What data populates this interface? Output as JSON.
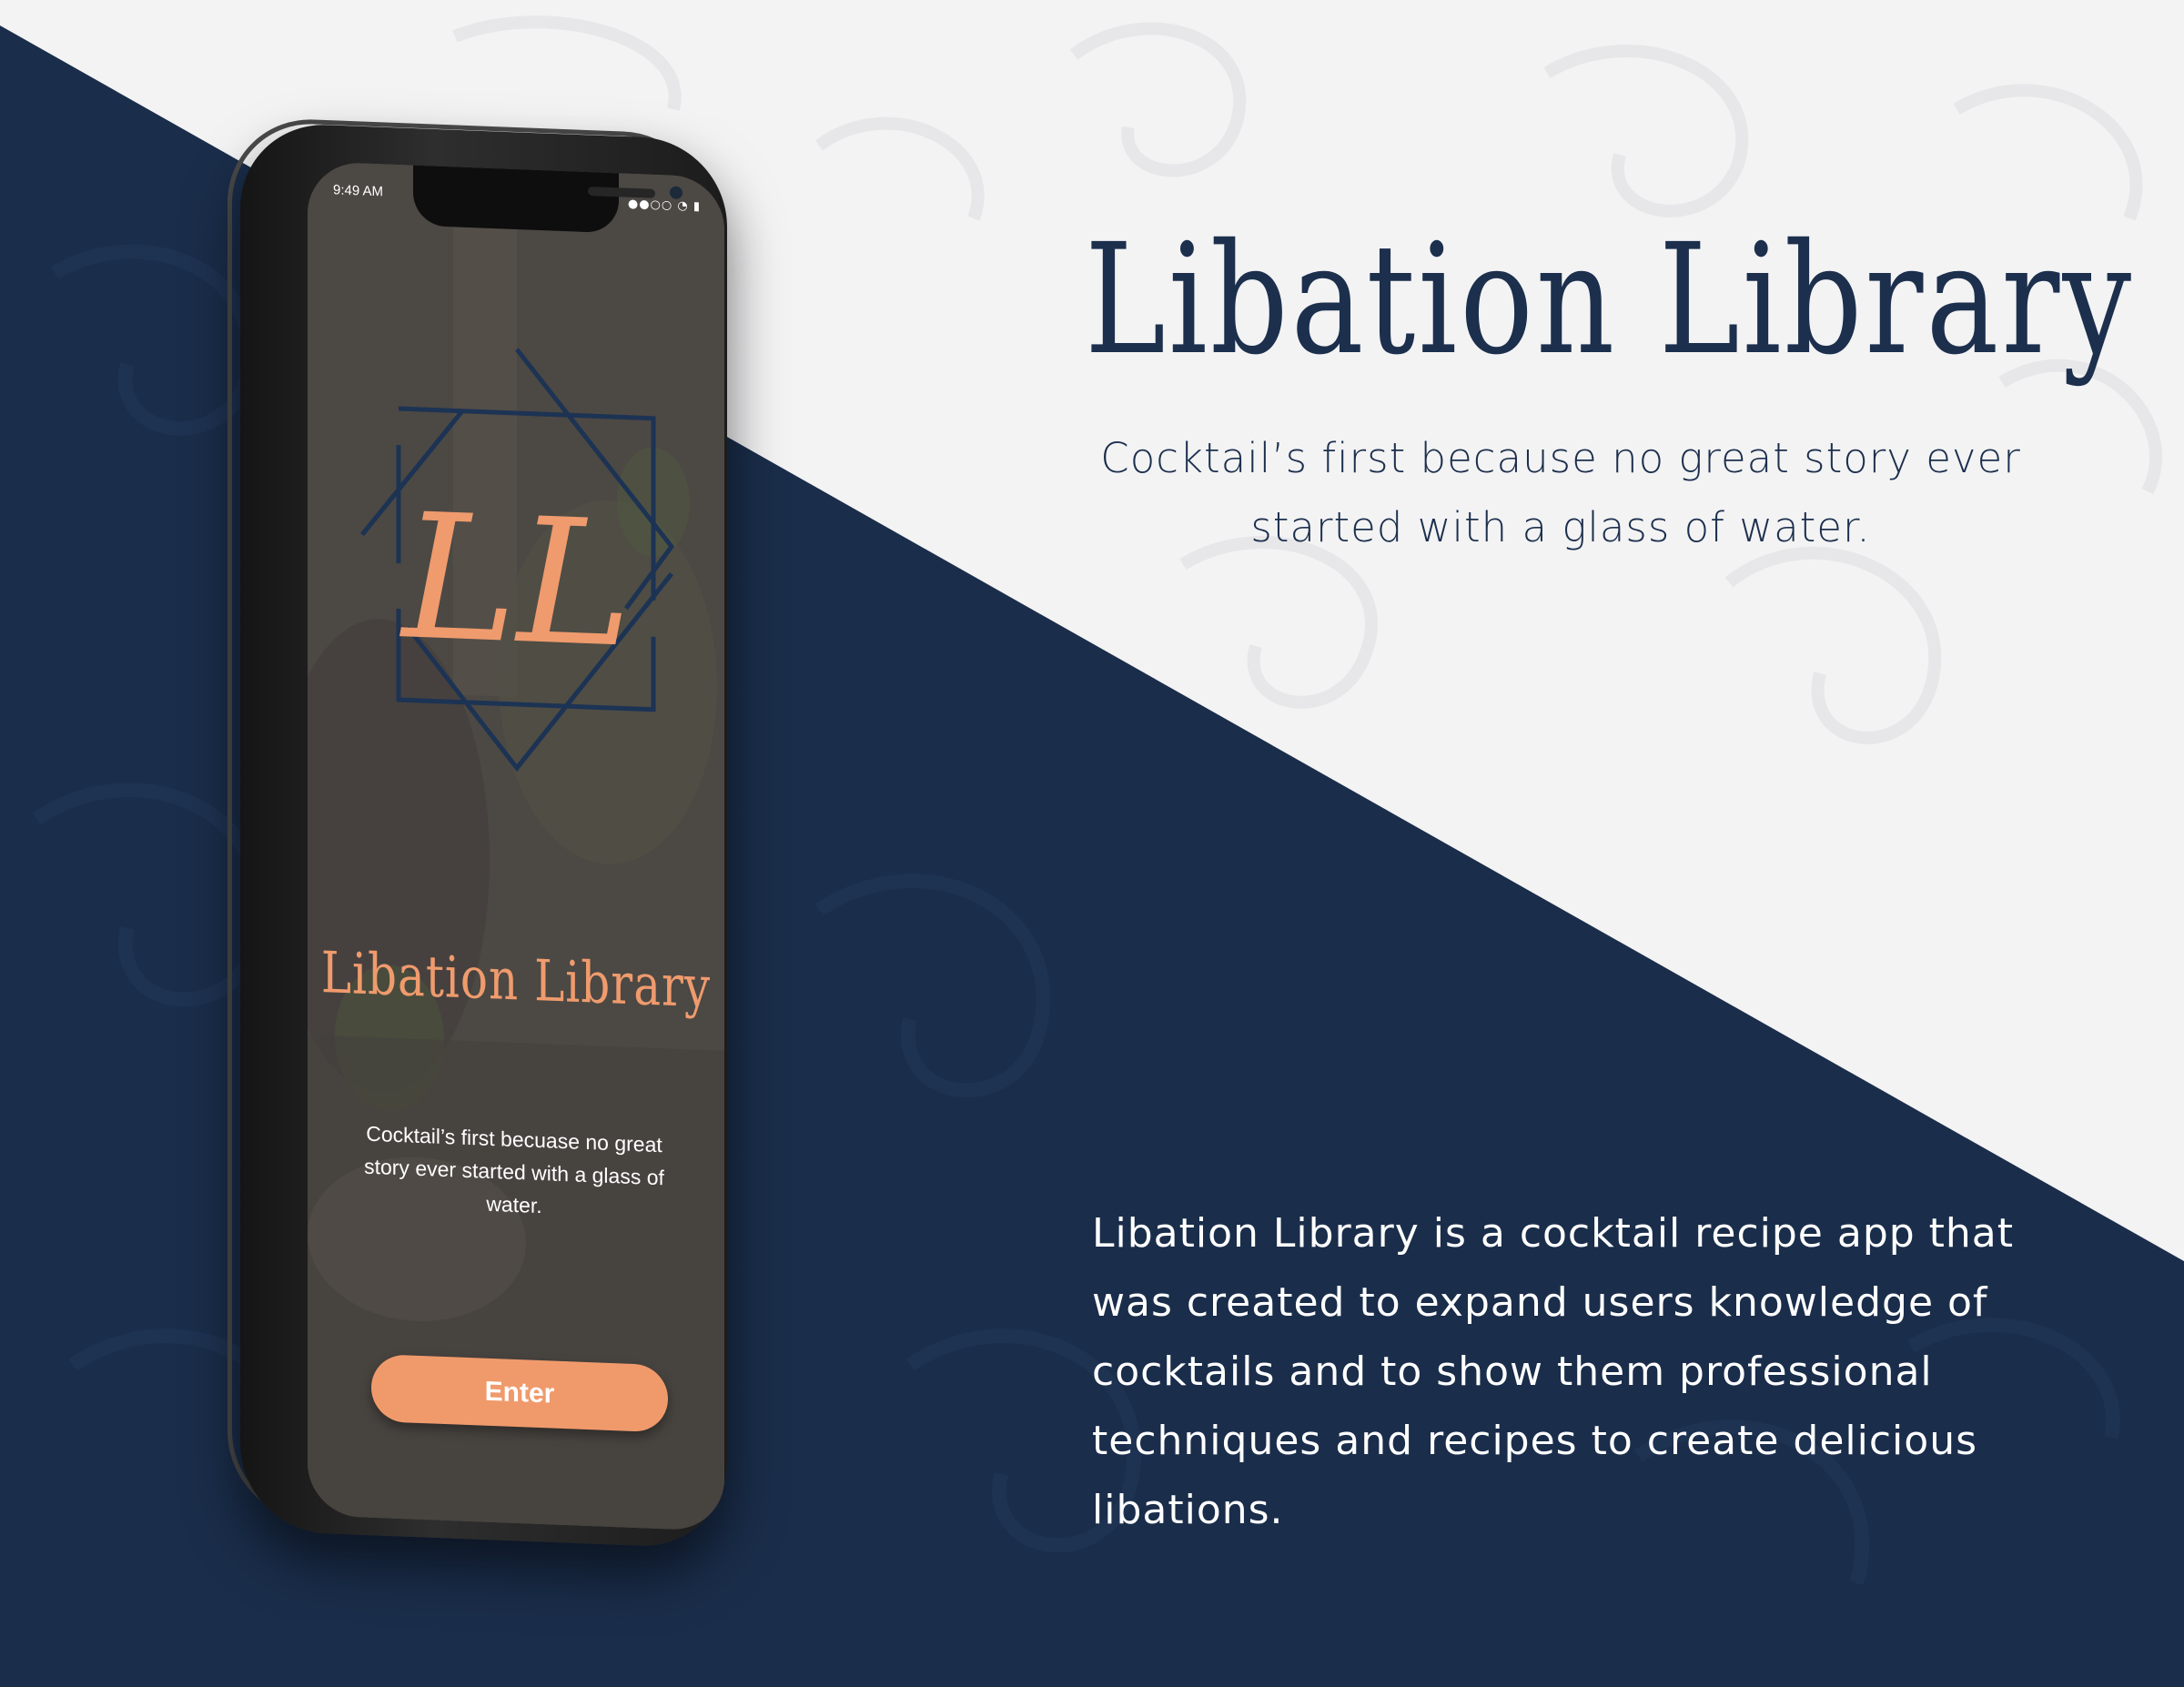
{
  "headline": {
    "title": "Libation Library",
    "tagline": "Cocktail’s first because no great story ever started with a glass of water."
  },
  "description": "Libation Library is a cocktail recipe app that was created to expand users knowledge of cocktails and to show them professional techniques and recipes to create delicious libations.",
  "phone": {
    "status_time": "9:49 AM",
    "status_icons": "●●○○ ◔ ▮",
    "logo_letters": "LL",
    "app_title": "Libation Library",
    "app_tagline": "Cocktail’s first becuase no great story ever started with a glass of water.",
    "enter_label": "Enter"
  },
  "colors": {
    "navy": "#1a2d4a",
    "light_background": "#f3f3f4",
    "accent_peach": "#f09a6c",
    "title_navy": "#1c2f4d"
  }
}
